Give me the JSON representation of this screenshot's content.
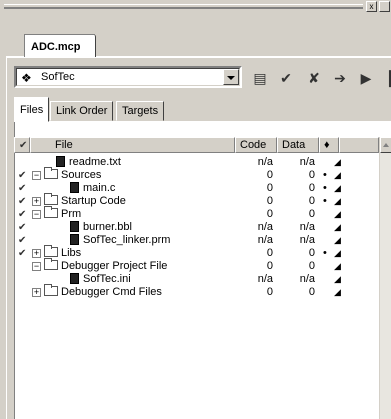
{
  "window": {
    "close_glyph": "x"
  },
  "project_tab": "ADC.mcp",
  "target_combo": {
    "value": "SofTec",
    "icon": "target-settings-icon"
  },
  "toolbar": [
    {
      "name": "settings-icon",
      "glyph": "▤"
    },
    {
      "name": "make-icon",
      "glyph": "✔"
    },
    {
      "name": "debug-icon",
      "glyph": "✘"
    },
    {
      "name": "sync-icon",
      "glyph": "➔"
    },
    {
      "name": "run-icon",
      "glyph": "▶"
    },
    {
      "name": "project-inspector-icon",
      "glyph": "▐"
    }
  ],
  "subtabs": [
    "Files",
    "Link Order",
    "Targets"
  ],
  "columns": {
    "check": "✔",
    "file": "File",
    "code": "Code",
    "data": "Data",
    "debug": "♦"
  },
  "rows": [
    {
      "check": "",
      "name": "readme.txt",
      "code": "n/a",
      "data": "n/a",
      "dot": "",
      "kind": "file",
      "depth": 1,
      "expander": ""
    },
    {
      "check": "✔",
      "name": "Sources",
      "code": "0",
      "data": "0",
      "dot": "•",
      "kind": "folder-open",
      "depth": 0,
      "expander": "−"
    },
    {
      "check": "✔",
      "name": "main.c",
      "code": "0",
      "data": "0",
      "dot": "•",
      "kind": "file",
      "depth": 2,
      "expander": ""
    },
    {
      "check": "✔",
      "name": "Startup Code",
      "code": "0",
      "data": "0",
      "dot": "•",
      "kind": "folder",
      "depth": 0,
      "expander": "+"
    },
    {
      "check": "✔",
      "name": "Prm",
      "code": "0",
      "data": "0",
      "dot": "",
      "kind": "folder-open",
      "depth": 0,
      "expander": "−"
    },
    {
      "check": "✔",
      "name": "burner.bbl",
      "code": "n/a",
      "data": "n/a",
      "dot": "",
      "kind": "file",
      "depth": 2,
      "expander": ""
    },
    {
      "check": "✔",
      "name": "SofTec_linker.prm",
      "code": "n/a",
      "data": "n/a",
      "dot": "",
      "kind": "file",
      "depth": 2,
      "expander": ""
    },
    {
      "check": "✔",
      "name": "Libs",
      "code": "0",
      "data": "0",
      "dot": "•",
      "kind": "folder",
      "depth": 0,
      "expander": "+"
    },
    {
      "check": "",
      "name": "Debugger Project File",
      "code": "0",
      "data": "0",
      "dot": "",
      "kind": "folder-open",
      "depth": 0,
      "expander": "−"
    },
    {
      "check": "",
      "name": "SofTec.ini",
      "code": "n/a",
      "data": "n/a",
      "dot": "",
      "kind": "file",
      "depth": 2,
      "expander": ""
    },
    {
      "check": "",
      "name": "Debugger Cmd Files",
      "code": "0",
      "data": "0",
      "dot": "",
      "kind": "folder",
      "depth": 0,
      "expander": "+"
    }
  ]
}
